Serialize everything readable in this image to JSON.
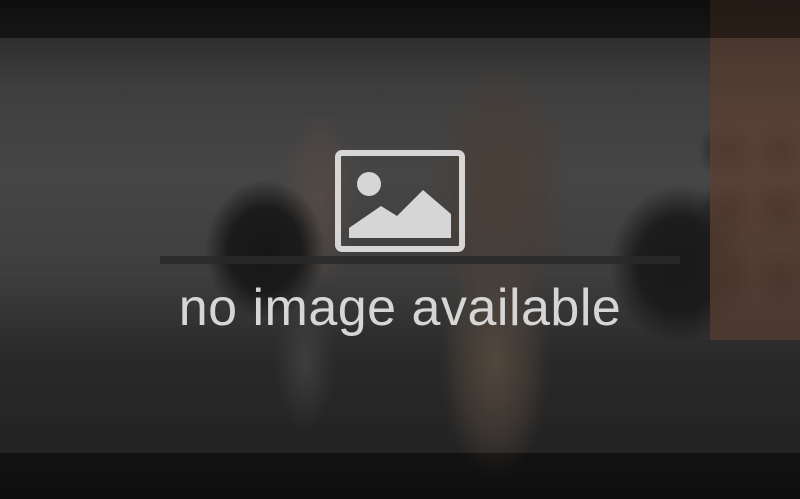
{
  "image": {
    "placeholder_text": "no image available",
    "icon": "image-placeholder-icon",
    "colors": {
      "placeholder_fg": "#d6d6d6",
      "overlay": "#282828"
    }
  }
}
